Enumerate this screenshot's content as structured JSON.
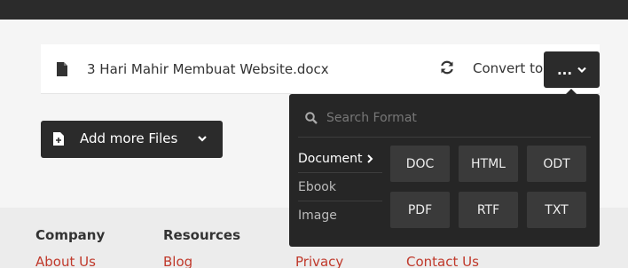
{
  "file": {
    "name": "3 Hari Mahir Membuat Website.docx",
    "convert_label": "Convert to",
    "format_button_label": "..."
  },
  "add_files": {
    "label": "Add more Files"
  },
  "footer": {
    "headings": [
      "Company",
      "Resources"
    ],
    "links": [
      "About Us",
      "Blog",
      "Privacy",
      "Contact Us"
    ]
  },
  "dropdown": {
    "search_placeholder": "Search Format",
    "categories": [
      {
        "label": "Document",
        "active": true
      },
      {
        "label": "Ebook",
        "active": false
      },
      {
        "label": "Image",
        "active": false
      }
    ],
    "formats": [
      "DOC",
      "HTML",
      "ODT",
      "PDF",
      "RTF",
      "TXT"
    ]
  },
  "colors": {
    "dark": "#2b2b2b",
    "link": "#c0392b",
    "dropdown_bg": "#262626",
    "format_tile": "#3a3a3a"
  }
}
